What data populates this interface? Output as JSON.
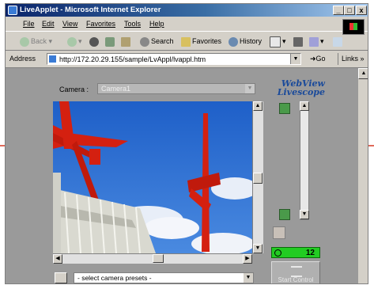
{
  "window": {
    "title": "LiveApplet - Microsoft Internet Explorer",
    "minimize": "_",
    "maximize": "□",
    "close": "x"
  },
  "menu": [
    "File",
    "Edit",
    "View",
    "Favorites",
    "Tools",
    "Help"
  ],
  "toolbar": {
    "back": "Back",
    "search": "Search",
    "favorites": "Favorites",
    "history": "History"
  },
  "address": {
    "label": "Address",
    "url": "http://172.20.29.155/sample/LvAppl/lvappl.htm",
    "go": "Go",
    "links": "Links »"
  },
  "applet": {
    "camera_label": "Camera :",
    "camera_value": "Camera1",
    "logo_line1": "WebView",
    "logo_line2": "Livescope",
    "counter": "12",
    "start_button": "Start Control",
    "preset_placeholder": "- select camera presets -"
  }
}
